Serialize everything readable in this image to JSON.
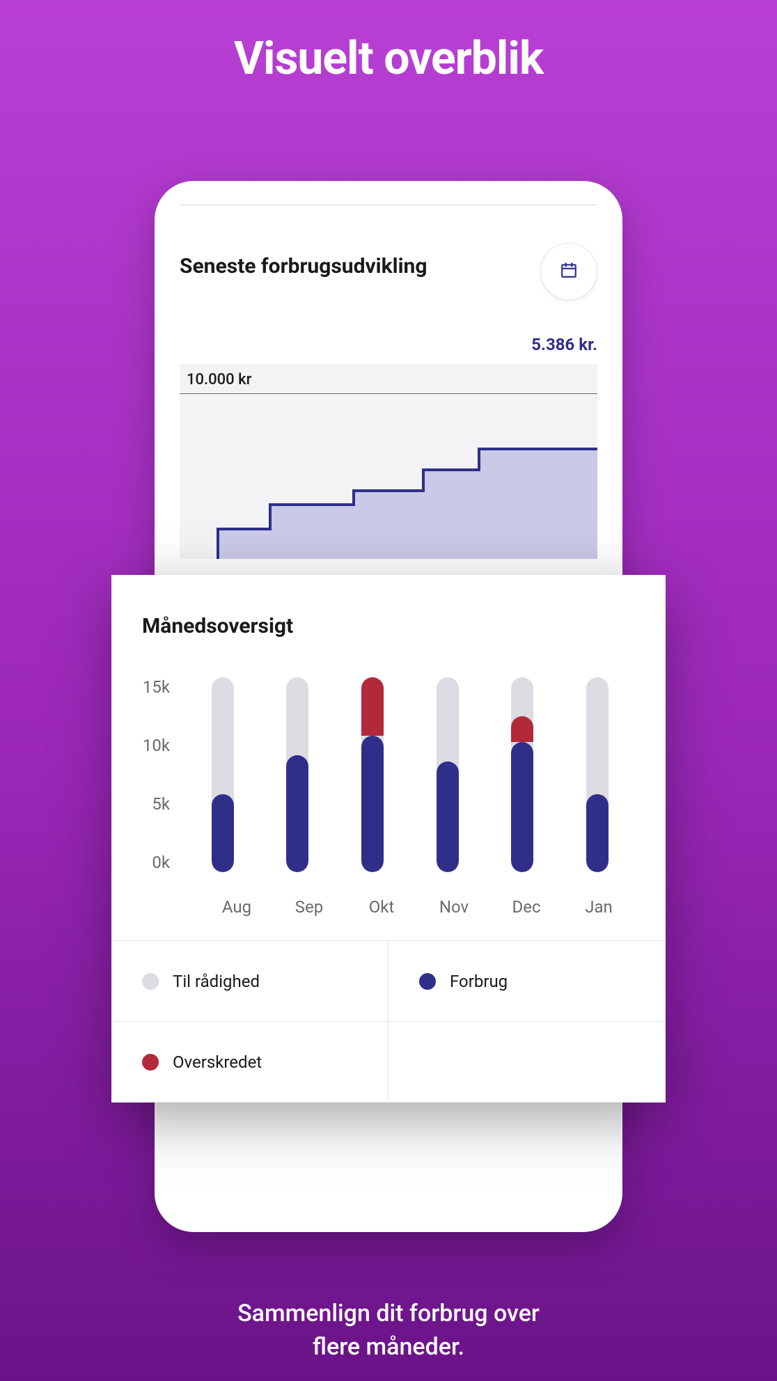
{
  "promo": {
    "title": "Visuelt overblik",
    "subtitle_line1": "Sammenlign dit forbrug over",
    "subtitle_line2": "flere måneder."
  },
  "card1": {
    "title": "Seneste forbrugsudvikling",
    "amount": "5.386 kr.",
    "ymax": "10.000 kr"
  },
  "overlay": {
    "title": "Månedsoversigt",
    "yticks": [
      "15k",
      "10k",
      "5k",
      "0k"
    ]
  },
  "legend": {
    "available": "Til rådighed",
    "usage": "Forbrug",
    "exceeded": "Overskredet"
  },
  "colors": {
    "blue": "#2f2f8a",
    "red": "#b2293a",
    "grey": "#dcdce2"
  },
  "chart_data": {
    "type": "bar",
    "categories": [
      "Aug",
      "Sep",
      "Okt",
      "Nov",
      "Dec",
      "Jan"
    ],
    "series": [
      {
        "name": "Til rådighed",
        "values": [
          15,
          15,
          15,
          15,
          15,
          15
        ]
      },
      {
        "name": "Forbrug",
        "values": [
          6,
          9,
          10.5,
          8.5,
          10,
          6
        ]
      },
      {
        "name": "Overskredet",
        "values": [
          0,
          0,
          5,
          0,
          2,
          0
        ]
      }
    ],
    "ylabel": "",
    "xlabel": "",
    "ylim": [
      0,
      15
    ],
    "y_unit": "k"
  }
}
